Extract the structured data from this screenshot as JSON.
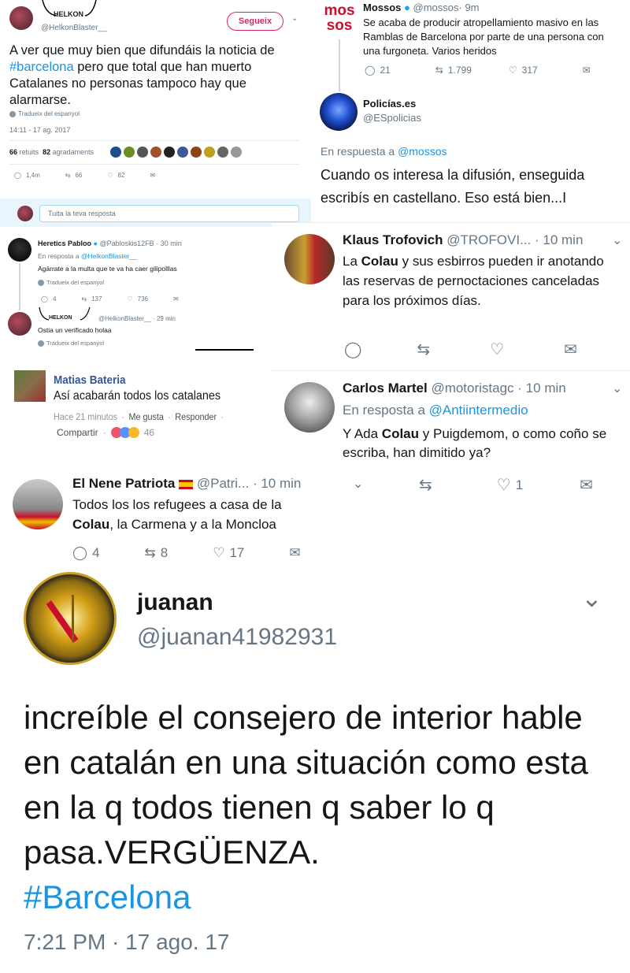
{
  "p1": {
    "logo_text": "HELKON",
    "handle": "@HelkonBlaster__",
    "follow_label": "Segueix",
    "text_before": "A ver que muy bien que difundáis la noticia de ",
    "hashtag": "#barcelona",
    "text_after": " pero que total que han muerto Catalanes no personas tampoco hay que alarmarse.",
    "translate": "Tradueix del espanyol",
    "timestamp": "14:11 - 17 ag. 2017",
    "retweets_count": "66",
    "retweets_label": "retuits",
    "likes_count": "82",
    "likes_label": "agradaments",
    "reply_count": "1,4m",
    "rt_count": "66",
    "like_count": "82",
    "reply_placeholder": "Tuita la teva resposta"
  },
  "p2": {
    "name": "Heretics Pabloo",
    "handle": "@Pabloskis12FB",
    "time": "· 30 min",
    "in_reply_prefix": "En resposta a ",
    "in_reply_handle": "@HelkonBlaster__",
    "text": "Agárrate a la multa que te va ha caer gilipolllas",
    "translate": "Tradueix del espanyol",
    "reply_count": "4",
    "rt_count": "137",
    "like_count": "736",
    "reply2_logo": "HELKON",
    "reply2_handle": "@HelkonBlaster__",
    "reply2_time": "· 29 min",
    "reply2_text": "Ostia un verificado holaa",
    "reply2_translate": "Tradueix del espanyol"
  },
  "p3": {
    "name": "Matias Bateria",
    "text": "Así acabarán todos los catalanes",
    "time": "Hace 21 minutos",
    "like": "Me gusta",
    "reply": "Responder",
    "share": "Compartir",
    "reactions": "46"
  },
  "p4": {
    "name": "Mossos",
    "handle": "@mossos",
    "time": "· 9m",
    "logo_top": "mos",
    "logo_bottom": "sos",
    "text": "Se acaba de producir atropellamiento masivo en las Ramblas de Barcelona por parte de una persona con una furgoneta. Varios heridos",
    "reply_count": "21",
    "rt_count": "1.799",
    "like_count": "317",
    "reply_name": "Policías.es",
    "reply_handle": "@ESpolicias",
    "in_reply_prefix": "En respuesta a ",
    "in_reply_handle": "@mossos",
    "reply_text": "Cuando os interesa la difusión, enseguida escribís en castellano. Eso está bien...I"
  },
  "p5": {
    "t1_name": "Klaus Trofovich",
    "t1_handle": "@TROFOVI...",
    "t1_time": "· 10 min",
    "t1_bold": "Colau",
    "t1_pre": "La ",
    "t1_post": " y sus esbirros pueden ir anotando las reservas  de pernoctaciones canceladas para los próximos días.",
    "t2_name": "Carlos Martel",
    "t2_handle": "@motoristagc",
    "t2_time": "· 10 min",
    "t2_in_reply_prefix": "En resposta a ",
    "t2_in_reply_handle": "@Antiintermedio",
    "t2_pre": "Y Ada ",
    "t2_bold": "Colau",
    "t2_post": " y Puigdemom, o como coño se escriba, han dimitido ya?",
    "t2_like_count": "1"
  },
  "p6": {
    "name": "El Nene Patriota",
    "handle": "@Patri...",
    "time": "· 10 min",
    "line1": "Todos los los refugees a casa de la",
    "bold": "Colau",
    "line2_post": ", la Carmena y a la Moncloa",
    "reply_count": "4",
    "rt_count": "8",
    "like_count": "17"
  },
  "p7": {
    "name": "juanan",
    "handle": "@juanan41982931",
    "text": "increíble el consejero de interior hable en catalán en una situación como esta en la q todos tienen q saber lo q pasa.VERGÜENZA.",
    "hashtag": "#Barcelona",
    "timestamp": "7:21 PM · 17 ago. 17"
  },
  "colors": {
    "link": "#1b95e0",
    "muted": "#657786",
    "mossos_red": "#c8102e",
    "follow_red": "#e0245e"
  }
}
